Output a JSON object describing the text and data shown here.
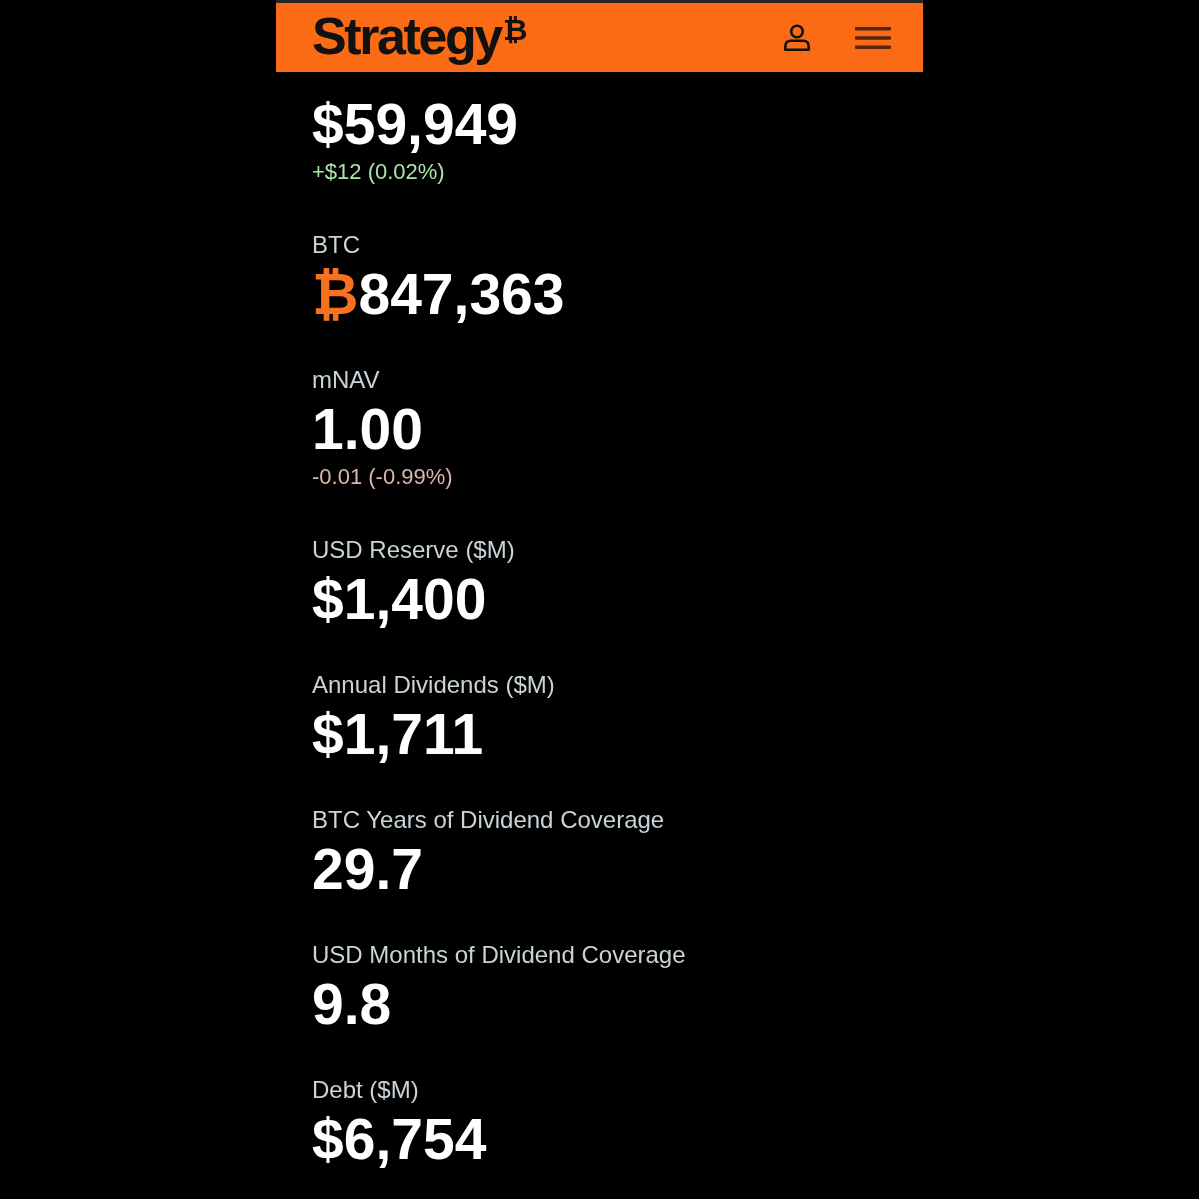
{
  "header": {
    "logo": "Strategy$^{₿}$"
  },
  "metrics": [
    {
      "value": "$59,949",
      "change": {
        "text": "+$12 (0.02%)",
        "kind": "gain"
      }
    },
    {
      "label": "BTC",
      "unit": "₿",
      "value": "847,363"
    },
    {
      "label": "mNAV",
      "value": "1.00",
      "change": {
        "text": "-0.01 (-0.99%)",
        "kind": "loss"
      }
    },
    {
      "label": "USD Reserve ($M)",
      "value": "$1,400"
    },
    {
      "label": "Annual Dividends ($M)",
      "value": "$1,711"
    },
    {
      "label": "BTC Years of Dividend Coverage",
      "value": "29.7"
    },
    {
      "label": "USD Months of Dividend Coverage",
      "value": "9.8"
    },
    {
      "label": "Debt ($M)",
      "value": "$6,754"
    }
  ]
}
